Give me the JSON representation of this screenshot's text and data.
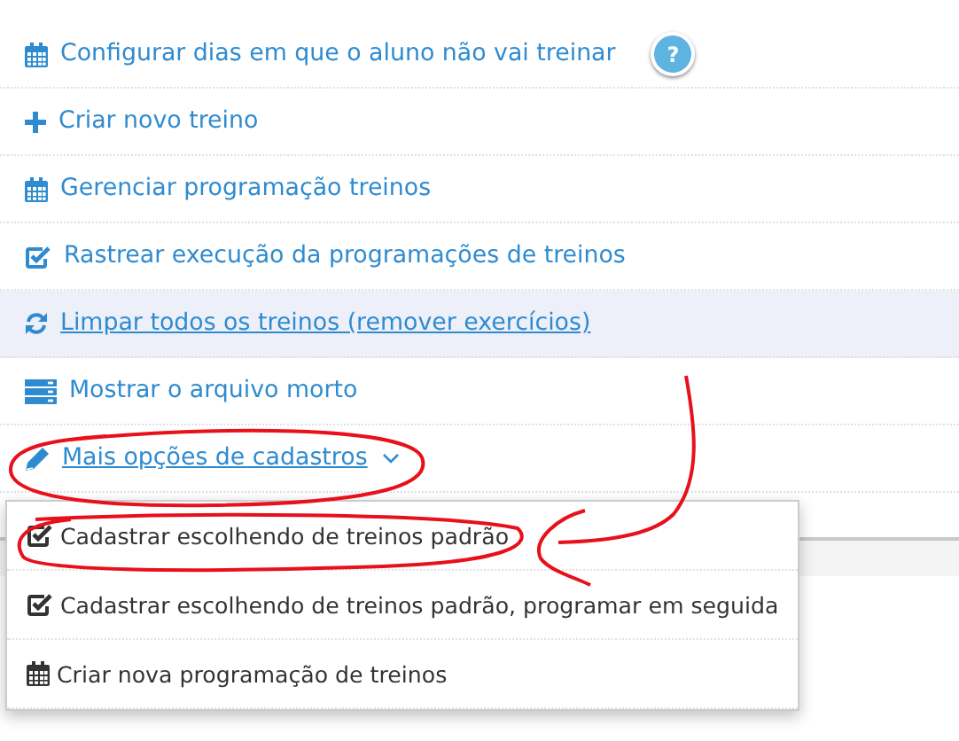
{
  "menu": {
    "items": [
      {
        "kind": "calendar",
        "label": "Configurar dias em que o aluno não vai treinar",
        "help_badge": "?",
        "highlighted": false,
        "underlined": false
      },
      {
        "kind": "plus",
        "label": "Criar novo treino",
        "highlighted": false,
        "underlined": false
      },
      {
        "kind": "calendar",
        "label": "Gerenciar programação treinos",
        "highlighted": false,
        "underlined": false
      },
      {
        "kind": "check",
        "label": "Rastrear execução da programações de treinos",
        "highlighted": false,
        "underlined": false
      },
      {
        "kind": "refresh",
        "label": "Limpar todos os treinos (remover exercícios)",
        "highlighted": true,
        "underlined": true
      },
      {
        "kind": "archive",
        "label": "Mostrar o arquivo morto",
        "highlighted": false,
        "underlined": false
      },
      {
        "kind": "pencil",
        "label": "Mais opções de cadastros",
        "highlighted": false,
        "underlined": true,
        "expanded": true
      }
    ]
  },
  "dropdown": {
    "items": [
      {
        "kind": "check",
        "label": "Cadastrar escolhendo de treinos padrão"
      },
      {
        "kind": "check",
        "label": "Cadastrar escolhendo de treinos padrão, programar em seguida"
      },
      {
        "kind": "calendar",
        "label": "Criar nova programação de treinos"
      }
    ]
  }
}
